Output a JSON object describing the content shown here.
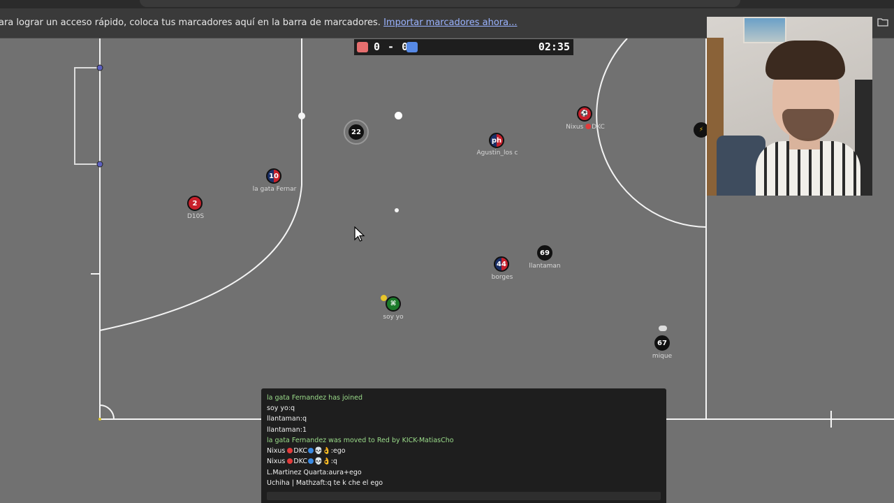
{
  "browser": {
    "bookmark_bar_message": "ara lograr un acceso rápido, coloca tus marcadores aquí en la barra de marcadores.",
    "import_link": "Importar marcadores ahora...",
    "folder_icon": "folder-icon"
  },
  "scoreboard": {
    "red_color": "#e56e6e",
    "blue_color": "#5689e5",
    "score": "0 - 0",
    "time": "02:35"
  },
  "players": [
    {
      "id": "d10s",
      "number": "2",
      "name": "D10S",
      "team": "red"
    },
    {
      "id": "la-gata",
      "number": "10",
      "name": "la gata Fernar",
      "team": "red"
    },
    {
      "id": "ring-22",
      "number": "22",
      "name": "",
      "team": "black"
    },
    {
      "id": "agustin",
      "number": "ph",
      "name": "Agustin_los c",
      "team": "red"
    },
    {
      "id": "nixus",
      "number": "⚽",
      "name": "Nixus",
      "name_suffix": "DKC",
      "team": "red"
    },
    {
      "id": "lightning",
      "number": "⚡",
      "name": "",
      "team": "black"
    },
    {
      "id": "llantaman",
      "number": "69",
      "name": "llantaman",
      "team": "black"
    },
    {
      "id": "borges",
      "number": "44",
      "name": "borges",
      "team": "red"
    },
    {
      "id": "soy-yo",
      "number": "⌘",
      "name": "soy yo",
      "team": "green"
    },
    {
      "id": "mique",
      "number": "67",
      "name": "mique",
      "team": "black"
    }
  ],
  "chat": {
    "lines": [
      {
        "text": "la gata Fernandez has joined",
        "type": "system"
      },
      {
        "text": "soy yo:q",
        "type": "user"
      },
      {
        "text": "llantaman:q",
        "type": "user"
      },
      {
        "text": "llantaman:1",
        "type": "user"
      },
      {
        "text": "la gata Fernandez was moved to Red by KICK-MatiasCho",
        "type": "system"
      },
      {
        "text_before": "Nixus",
        "text_mid": "DKC",
        "text_after": "💀👌:ego",
        "type": "user-dots"
      },
      {
        "text_before": "Nixus",
        "text_mid": "DKC",
        "text_after": "💀👌:q",
        "type": "user-dots"
      },
      {
        "text": "L.Martinez Quarta:aura+ego",
        "type": "user"
      },
      {
        "text": "Uchiha | Mathzaft:q te k che el ego",
        "type": "user"
      }
    ]
  }
}
